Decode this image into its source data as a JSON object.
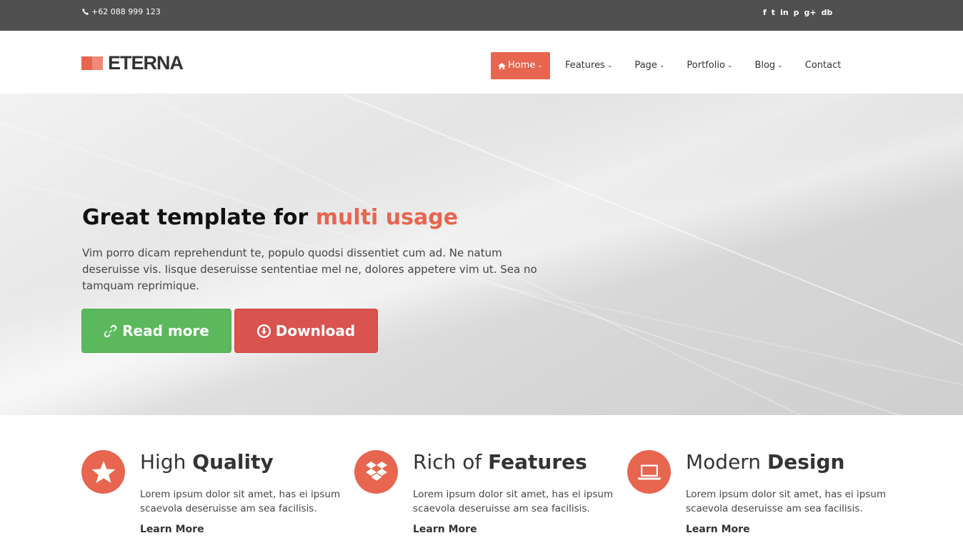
{
  "topbar": {
    "phone": "+62 088 999 123",
    "social": [
      "f",
      "t",
      "in",
      "p",
      "g+",
      "db"
    ],
    "social_icons": [
      "facebook-icon",
      "twitter-icon",
      "linkedin-icon",
      "pinterest-icon",
      "google-plus-icon",
      "dribbble-icon"
    ]
  },
  "header": {
    "logo": "ETERNA",
    "nav": [
      {
        "label": "Home",
        "active": true
      },
      {
        "label": "Features"
      },
      {
        "label": "Page"
      },
      {
        "label": "Portfolio"
      },
      {
        "label": "Blog"
      },
      {
        "label": "Contact"
      }
    ]
  },
  "hero": {
    "title_plain": "Great template for",
    "title_accent": "multi usage",
    "text": "Vim porro dicam reprehendunt te, populo quodsi dissentiet cum ad. Ne natum deseruisse vis. Iisque deseruisse sententiae mel ne, dolores appetere vim ut. Sea no tamquam reprimique.",
    "read_more": "Read more",
    "download": "Download"
  },
  "features": [
    {
      "title_light": "High",
      "title_bold": "Quality",
      "text": "Lorem ipsum dolor sit amet, has ei ipsum scaevola deseruisse am sea facilisis.",
      "link": "Learn More",
      "icon": "star-icon"
    },
    {
      "title_light": "Rich of",
      "title_bold": "Features",
      "text": "Lorem ipsum dolor sit amet, has ei ipsum scaevola deseruisse am sea facilisis.",
      "link": "Learn More",
      "icon": "dropbox-icon"
    },
    {
      "title_light": "Modern",
      "title_bold": "Design",
      "text": "Lorem ipsum dolor sit amet, has ei ipsum scaevola deseruisse am sea facilisis.",
      "link": "Learn More",
      "icon": "laptop-icon"
    }
  ],
  "colors": {
    "accent": "#e8654f",
    "topbar": "#505050",
    "green": "#5cb85c",
    "red": "#d9534f"
  }
}
